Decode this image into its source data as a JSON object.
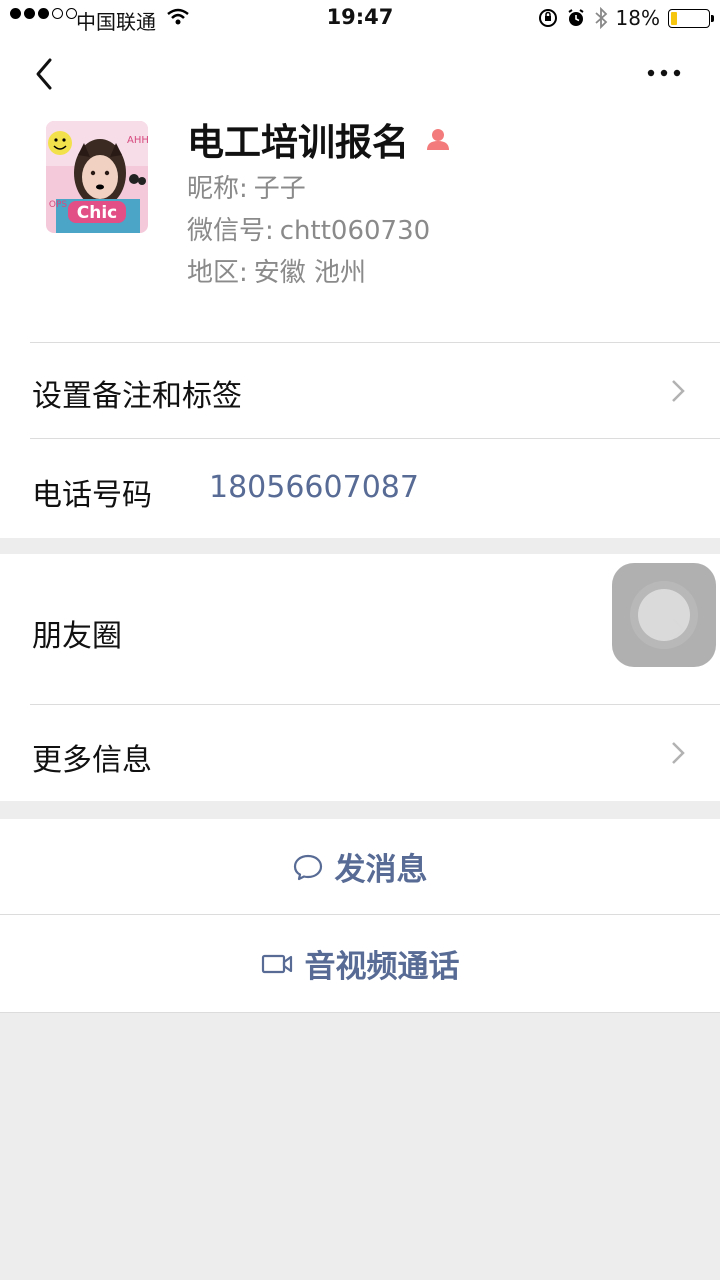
{
  "status_bar": {
    "carrier": "中国联通",
    "time": "19:47",
    "battery_percent": "18%",
    "battery_level": 0.18,
    "battery_color": "#f6c50e"
  },
  "header": {
    "back_icon": "chevron-left-icon",
    "more_icon": "more-dots-icon"
  },
  "profile": {
    "name": "电工培训报名",
    "gender_icon": "female-user-icon",
    "nickname_label": "昵称:",
    "nickname": "子子",
    "wechat_id_label": "微信号:",
    "wechat_id": "chtt060730",
    "region_label": "地区:",
    "region": "安徽 池州"
  },
  "rows": {
    "remark_label": "设置备注和标签",
    "phone_label": "电话号码",
    "phone_value": "18056607087",
    "moments_label": "朋友圈",
    "more_info_label": "更多信息"
  },
  "actions": {
    "message_label": "发消息",
    "message_icon": "chat-bubble-icon",
    "video_label": "音视频通话",
    "video_icon": "video-camera-icon"
  },
  "colors": {
    "link": "#576b95",
    "background": "#ededed",
    "gender_icon": "#f37b7b"
  }
}
